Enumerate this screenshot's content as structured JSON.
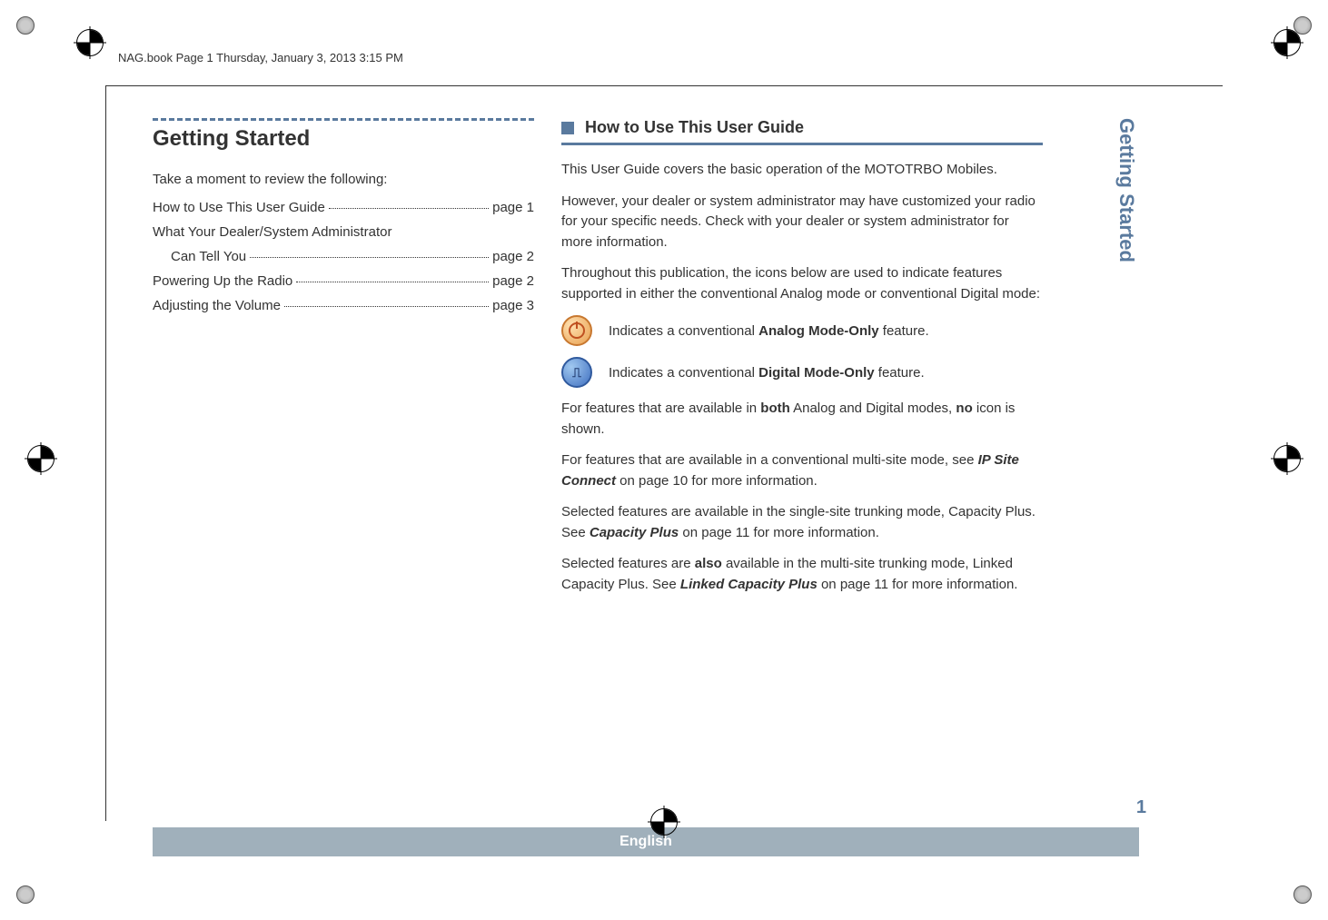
{
  "header": "NAG.book  Page 1  Thursday, January 3, 2013  3:15 PM",
  "left": {
    "title": "Getting Started",
    "intro": "Take a moment to review the following:",
    "toc": [
      {
        "label": "How to Use This User Guide",
        "page": "page 1",
        "indent": false
      },
      {
        "label": "What Your Dealer/System Administrator",
        "page": "",
        "indent": false
      },
      {
        "label": "Can Tell You",
        "page": "page 2",
        "indent": true
      },
      {
        "label": "Powering Up the Radio",
        "page": "page 2",
        "indent": false
      },
      {
        "label": "Adjusting the Volume",
        "page": "page 3",
        "indent": false
      }
    ]
  },
  "right": {
    "subsection_title": "How to Use This User Guide",
    "p1": "This User Guide covers the basic operation of the MOTOTRBO Mobiles.",
    "p2": "However, your dealer or system administrator may have customized your radio for your specific needs. Check with your dealer or system administrator for more information.",
    "p3": "Throughout this publication, the icons below are used to indicate features supported in either the conventional Analog mode or conventional Digital mode:",
    "analog_before": "Indicates a conventional ",
    "analog_bold": "Analog Mode-Only",
    "analog_after": " feature.",
    "digital_before": "Indicates a conventional ",
    "digital_bold": "Digital Mode-Only",
    "digital_after": " feature.",
    "p4_before": "For features that are available in ",
    "p4_bold1": "both",
    "p4_mid": " Analog and Digital modes, ",
    "p4_bold2": "no",
    "p4_after": " icon is shown.",
    "p5_before": "For features that are available in a conventional multi-site mode, see ",
    "p5_bold": "IP Site Connect",
    "p5_after": " on page 10 for more information.",
    "p6_before": "Selected features are available in the single-site trunking mode, Capacity Plus. See ",
    "p6_bold": "Capacity Plus",
    "p6_after": " on page 11 for more information.",
    "p7_before": "Selected features are ",
    "p7_bold1": "also",
    "p7_mid": " available in the multi-site trunking mode, Linked Capacity Plus. See ",
    "p7_bold2": "Linked Capacity Plus",
    "p7_after": " on page 11 for more information."
  },
  "sidebar": "Getting Started",
  "page_number": "1",
  "footer": "English"
}
